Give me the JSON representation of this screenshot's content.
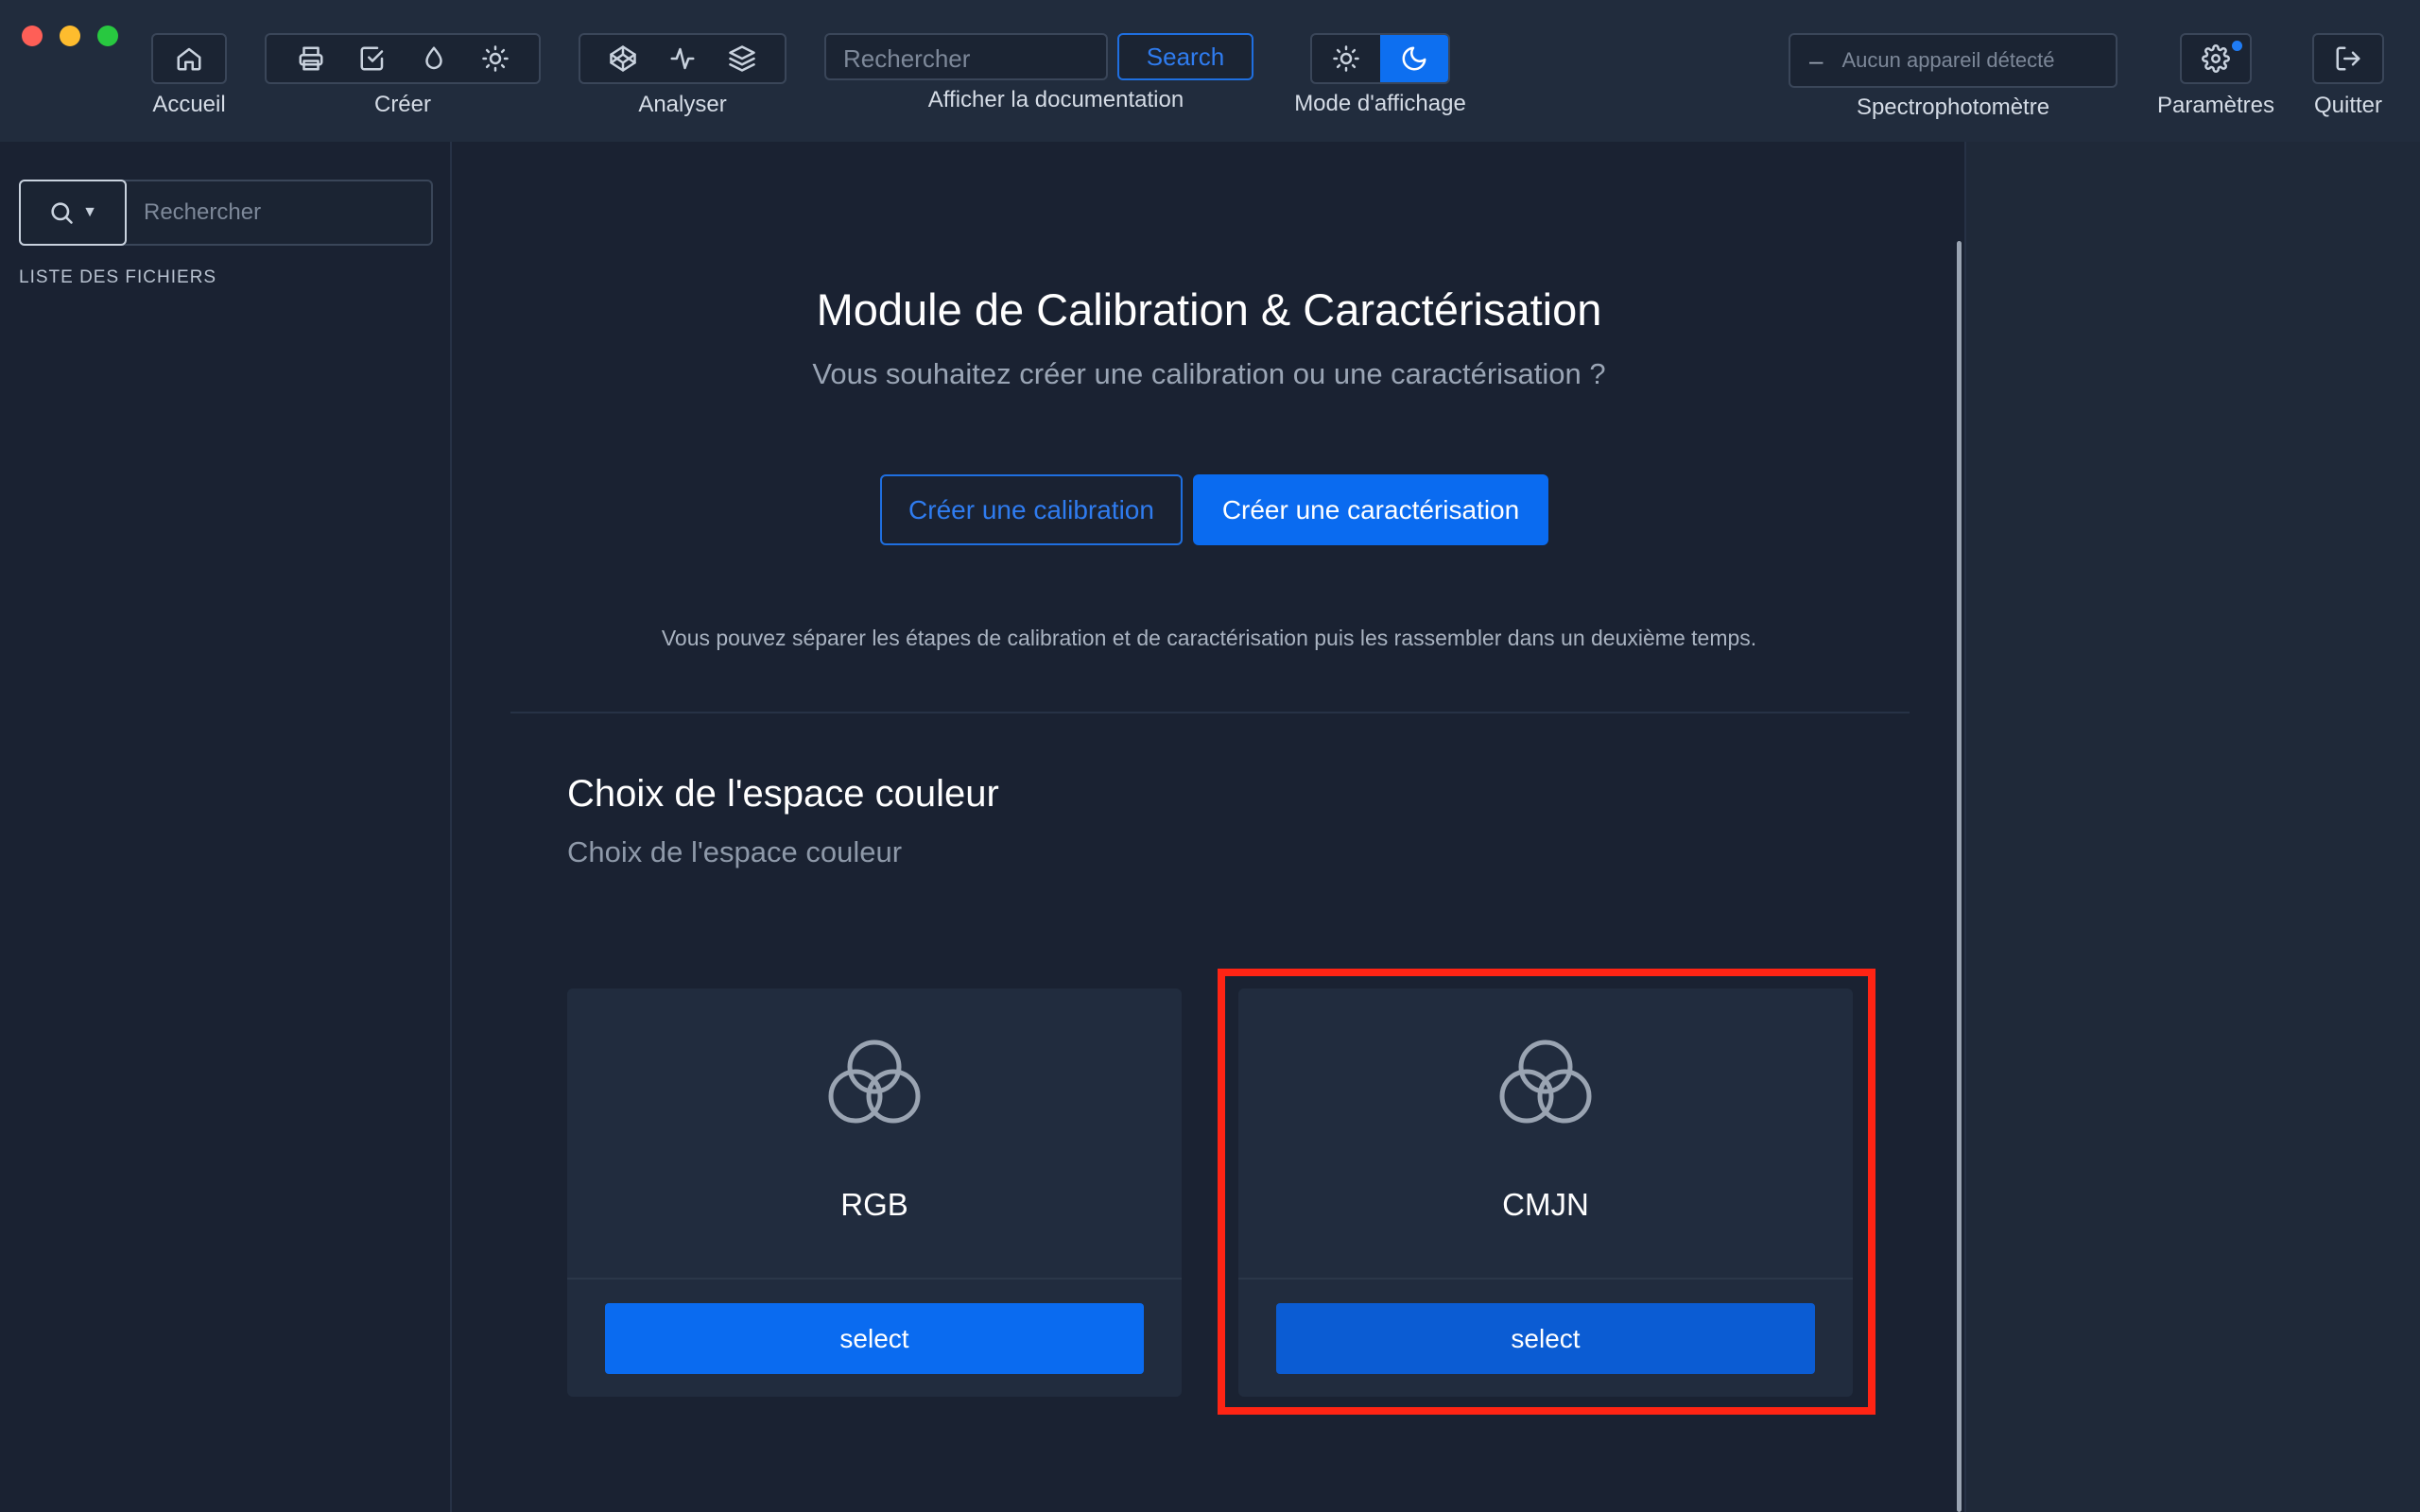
{
  "toolbar": {
    "home_label": "Accueil",
    "create_label": "Créer",
    "analyze_label": "Analyser",
    "search_placeholder": "Rechercher",
    "search_button": "Search",
    "doc_label": "Afficher la documentation",
    "display_mode_label": "Mode d'affichage",
    "device_status": "Aucun appareil détecté",
    "device_label": "Spectrophotomètre",
    "settings_label": "Paramètres",
    "quit_label": "Quitter"
  },
  "sidebar": {
    "search_placeholder": "Rechercher",
    "files_title": "LISTE DES FICHIERS"
  },
  "main": {
    "title": "Module de Calibration & Caractérisation",
    "subtitle": "Vous souhaitez créer une calibration ou une caractérisation ?",
    "btn_calibration": "Créer une calibration",
    "btn_characterization": "Créer une caractérisation",
    "note": "Vous pouvez séparer les étapes de calibration et de caractérisation puis les rassembler dans un deuxième temps.",
    "section_title": "Choix de l'espace couleur",
    "section_subtitle": "Choix de l'espace couleur",
    "cards": [
      {
        "label": "RGB",
        "button": "select"
      },
      {
        "label": "CMJN",
        "button": "select"
      }
    ]
  },
  "colors": {
    "accent": "#0a6bf0",
    "highlight": "#ff2414",
    "background": "#1a2232"
  }
}
